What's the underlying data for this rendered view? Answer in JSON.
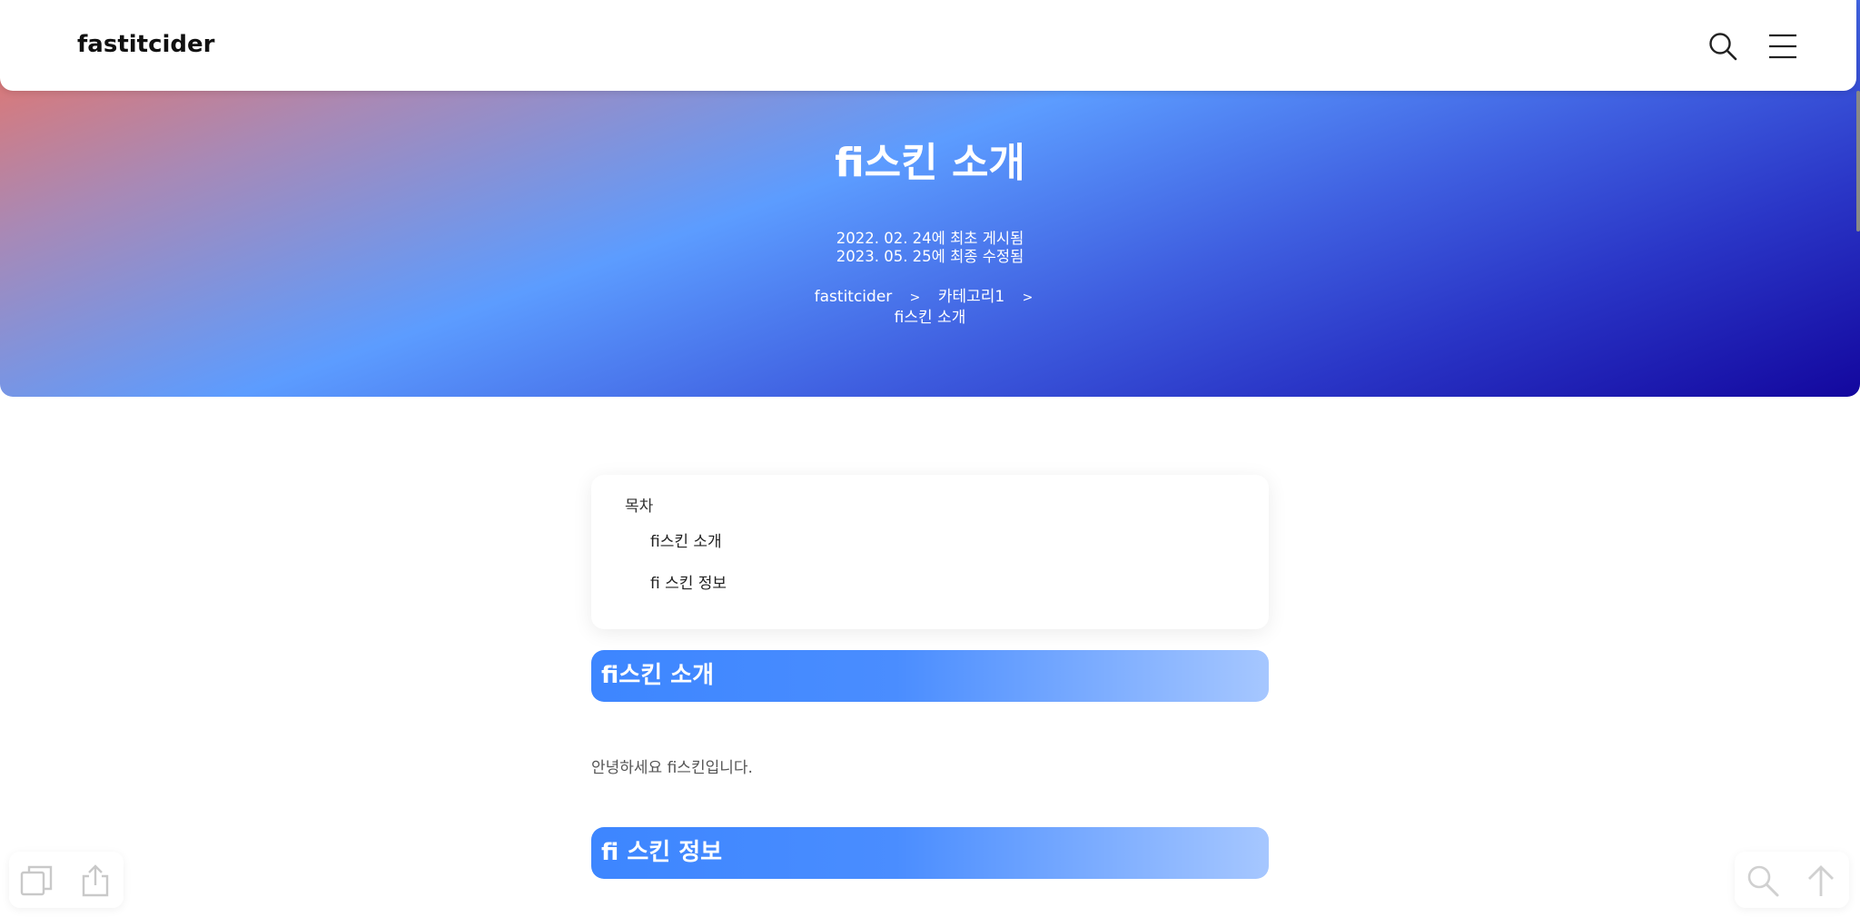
{
  "header": {
    "brand": "fastitcider",
    "icons": [
      "search-icon",
      "menu-icon"
    ]
  },
  "hero": {
    "title": "fi스킨 소개",
    "posted": "2022. 02. 24에 최초 게시됨",
    "updated": "2023. 05. 25에 최종 수정됨",
    "breadcrumb": [
      "fastitcider",
      "카테고리1",
      "fi스킨 소개"
    ],
    "separator": ">"
  },
  "toc": {
    "title": "목차",
    "items": [
      "fi스킨 소개",
      "fi 스킨 정보"
    ]
  },
  "sections": [
    {
      "heading": "fi스킨 소개",
      "text": "안녕하세요 fi스킨입니다."
    },
    {
      "heading": "fi 스킨 정보"
    }
  ],
  "floating": {
    "left_icons": [
      "copy-icon",
      "share-icon"
    ],
    "right_icons": [
      "search-icon",
      "arrow-up-icon"
    ]
  },
  "colors": {
    "accent": "#3d86ff",
    "gradient_start": "#f2715a",
    "gradient_end": "#13079e"
  }
}
